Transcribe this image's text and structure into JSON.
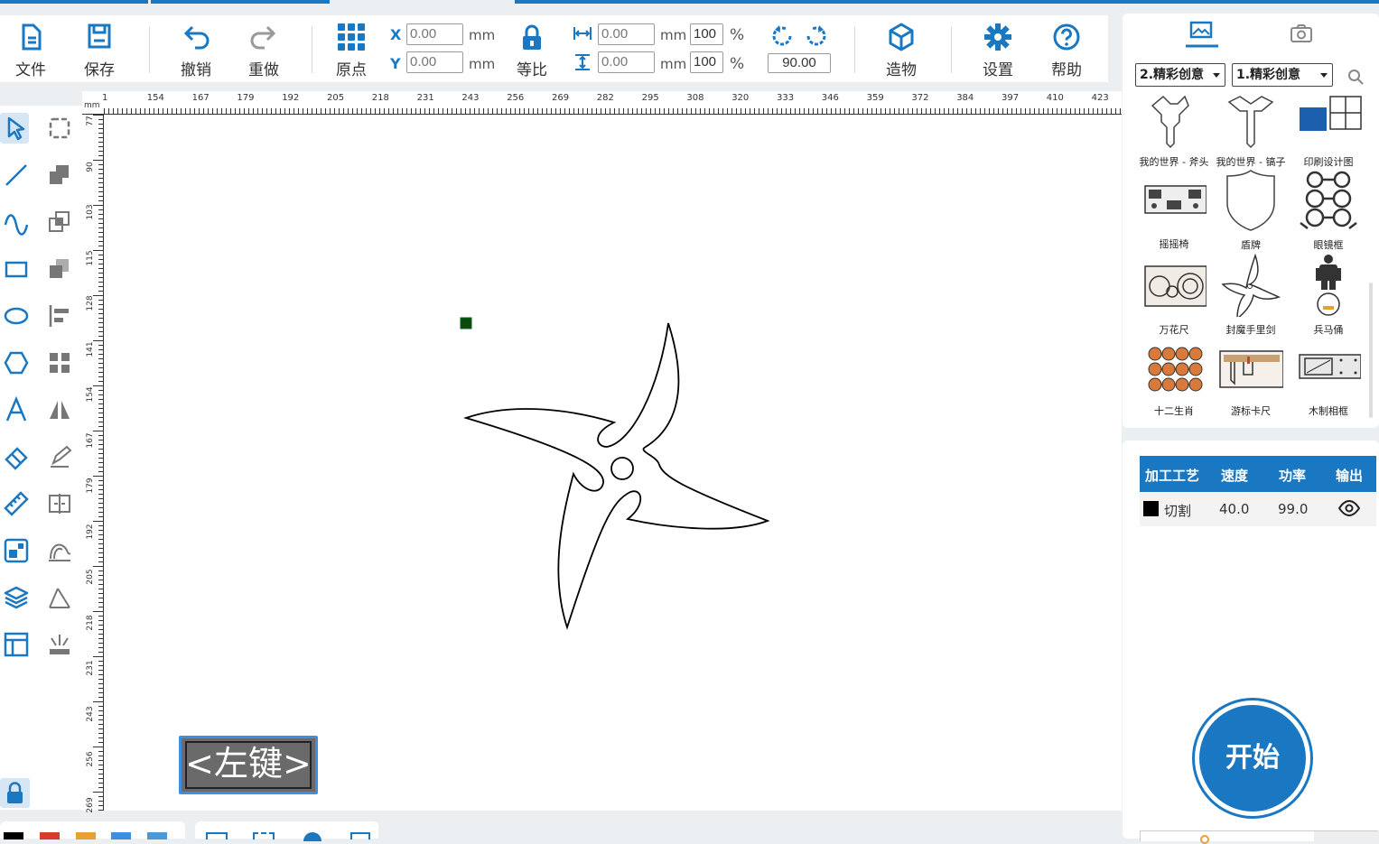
{
  "toolbar": {
    "file": "文件",
    "save": "保存",
    "undo": "撤销",
    "redo": "重做",
    "origin": "原点",
    "x_label": "X",
    "y_label": "Y",
    "x_value": "0.00",
    "y_value": "0.00",
    "unit_mm": "mm",
    "lock_ratio": "等比",
    "width_value": "0.00",
    "height_value": "0.00",
    "width_pct": "100",
    "height_pct": "100",
    "pct": "%",
    "rotation": "90.00",
    "build": "造物",
    "settings": "设置",
    "help": "帮助"
  },
  "ruler": {
    "unit": "mm",
    "top_ticks": [
      "1",
      "154",
      "167",
      "179",
      "192",
      "205",
      "218",
      "231",
      "243",
      "256",
      "269",
      "282",
      "295",
      "308",
      "320",
      "333",
      "346",
      "359",
      "372",
      "384",
      "397",
      "410",
      "423"
    ],
    "left_ticks": [
      "77",
      "90",
      "103",
      "115",
      "128",
      "141",
      "154",
      "167",
      "179",
      "192",
      "205",
      "218",
      "231",
      "243",
      "256",
      "269"
    ]
  },
  "gallery": {
    "dropdown1": "2.精彩创意",
    "dropdown2": "1.精彩创意",
    "items": [
      {
        "label": "我的世界 - 斧头"
      },
      {
        "label": "我的世界 - 镐子"
      },
      {
        "label": "印刷设计图"
      },
      {
        "label": "摇摇椅"
      },
      {
        "label": "盾牌"
      },
      {
        "label": "眼镜框"
      },
      {
        "label": "万花尺"
      },
      {
        "label": "封魔手里剑"
      },
      {
        "label": "兵马俑"
      },
      {
        "label": "十二生肖"
      },
      {
        "label": "游标卡尺"
      },
      {
        "label": "木制相框"
      }
    ]
  },
  "process": {
    "headers": [
      "加工工艺",
      "速度",
      "功率",
      "输出"
    ],
    "rows": [
      {
        "name": "切割",
        "speed": "40.0",
        "power": "99.0",
        "color": "#000000"
      }
    ]
  },
  "start_button": "开始",
  "hint": "<左键>",
  "colors": {
    "accent": "#1a78c2",
    "palette": [
      "#000000",
      "#d93a2b",
      "#e8a030",
      "#3d8ee0",
      "#4a9ad8"
    ]
  }
}
